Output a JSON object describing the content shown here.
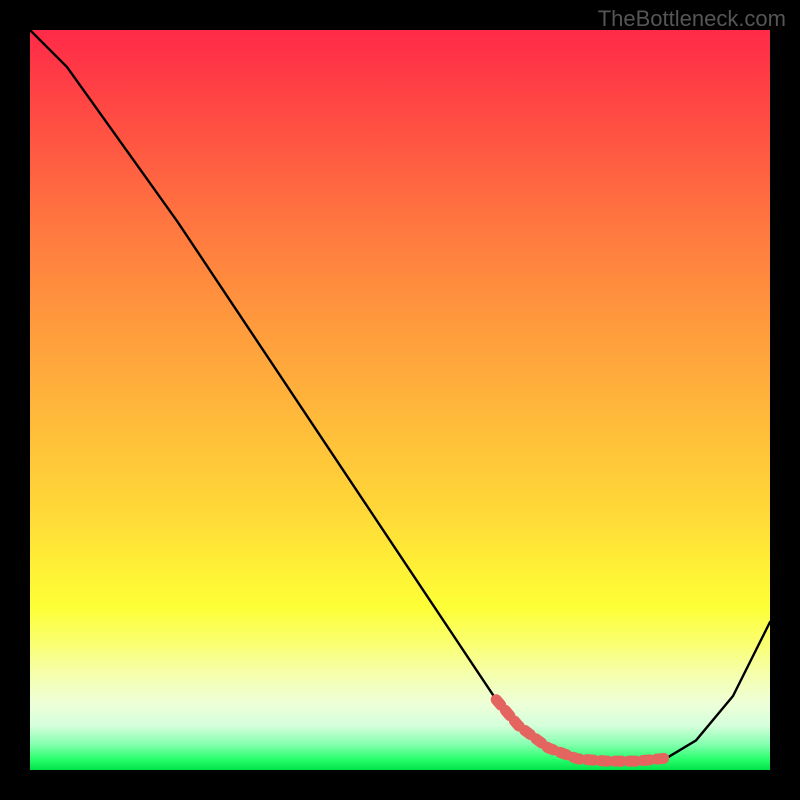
{
  "watermark": "TheBottleneck.com",
  "chart_data": {
    "type": "line",
    "title": "",
    "xlabel": "",
    "ylabel": "",
    "xlim": [
      0,
      100
    ],
    "ylim": [
      0,
      100
    ],
    "series": [
      {
        "name": "curve",
        "color": "#000000",
        "x": [
          0,
          5,
          10,
          15,
          20,
          25,
          30,
          35,
          40,
          45,
          50,
          55,
          60,
          63,
          66,
          70,
          74,
          78,
          82,
          86,
          90,
          95,
          100
        ],
        "y": [
          100,
          95,
          88,
          81,
          74,
          66.5,
          59,
          51.5,
          44,
          36.5,
          29,
          21.5,
          14,
          9.5,
          6,
          3,
          1.5,
          1.2,
          1.2,
          1.6,
          4,
          10,
          20
        ]
      },
      {
        "name": "highlight-band",
        "color": "#e4655f",
        "x": [
          63,
          66,
          70,
          74,
          78,
          82,
          86
        ],
        "y": [
          9.5,
          6,
          3,
          1.5,
          1.2,
          1.2,
          1.6
        ]
      }
    ],
    "annotations": []
  }
}
